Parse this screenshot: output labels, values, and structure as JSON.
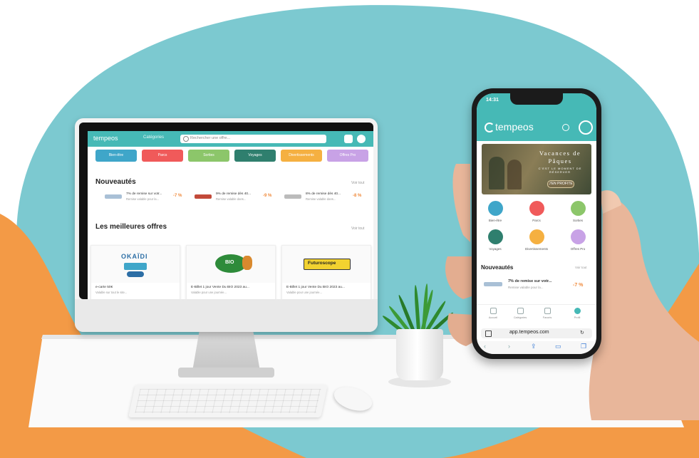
{
  "desktop": {
    "logo": "tempeos",
    "categories_link": "Catégories",
    "search_placeholder": "Rechercher une offre...",
    "chips": [
      {
        "label": "Bien-être",
        "color": "#3fa6c9"
      },
      {
        "label": "Parcs",
        "color": "#f05a5a"
      },
      {
        "label": "Sorties",
        "color": "#8cc66a"
      },
      {
        "label": "Voyages",
        "color": "#2f7f6e"
      },
      {
        "label": "Divertissements",
        "color": "#f5b041"
      },
      {
        "label": "Offres Pro",
        "color": "#c8a2e6"
      }
    ],
    "new_heading": "Nouveautés",
    "new_see_all": "Voir tout",
    "new_offers": [
      {
        "title": "7% de remise sur votr...",
        "subtitle": "Remise valable pour la...",
        "discount": "-7 %"
      },
      {
        "title": "9% de remise dès 40...",
        "subtitle": "Remise valable dans...",
        "discount": "-9 %"
      },
      {
        "title": "8% de remise dès 40...",
        "subtitle": "Remise valable dans...",
        "discount": "-8 %"
      }
    ],
    "best_heading": "Les meilleures offres",
    "best_see_all": "Voir tout",
    "best_offers": [
      {
        "brand": "OKAÏDI",
        "title": "e-carte 50€",
        "subtitle": "Valable sur tout le site..."
      },
      {
        "brand": "BIO",
        "title": "E-Billet 1 jour Vente Du BIO 2023 au...",
        "subtitle": "Valable pour une journée..."
      },
      {
        "brand": "Futuroscope",
        "title": "E-Billet 1 jour Vente Du BIO 2023 au...",
        "subtitle": "Valable pour une journée..."
      }
    ]
  },
  "phone": {
    "time": "14:31",
    "logo": "tempeos",
    "banner": {
      "title_line1": "Vacances de",
      "title_line2": "Pâques",
      "subtitle": "C'EST LE MOMENT DE RÉSERVER",
      "button": "J'EN PROFITE"
    },
    "categories": [
      {
        "label": "Bien-être",
        "color": "#3fa6c9"
      },
      {
        "label": "Parcs",
        "color": "#f05a5a"
      },
      {
        "label": "Sorties",
        "color": "#8cc66a"
      },
      {
        "label": "Voyages",
        "color": "#2f7f6e"
      },
      {
        "label": "Divertissements",
        "color": "#f5b041"
      },
      {
        "label": "Offres Pro",
        "color": "#c8a2e6"
      }
    ],
    "new_heading": "Nouveautés",
    "new_see_all": "Voir tout",
    "offer": {
      "title": "7% de remise sur votr...",
      "subtitle": "Remise valable pour la...",
      "discount": "-7 %"
    },
    "nav": [
      "Accueil",
      "Catégories",
      "Favoris",
      "Profil"
    ],
    "url": "app.tempeos.com"
  },
  "colors": {
    "teal": "#46b9b6",
    "orange": "#f39a46",
    "wall": "#7cc9d0"
  }
}
